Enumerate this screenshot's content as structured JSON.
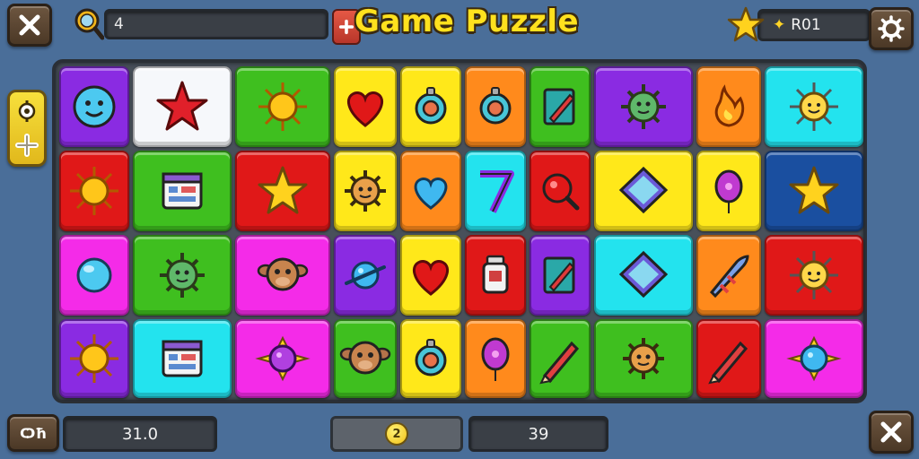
{
  "header": {
    "title": "Game Puzzle",
    "search": {
      "value": "4",
      "lens_icon": "magnifier-icon",
      "add_icon": "plus-icon"
    },
    "score": {
      "value": "R01",
      "star_icon": "star-icon"
    },
    "close_icon": "close-icon",
    "settings_icon": "gear-icon"
  },
  "side_panel": {
    "top_icon": "gear-icon",
    "bottom_icon": "plus-icon"
  },
  "footer": {
    "left_label": "Ѻħ",
    "left_value": "31.0",
    "coin_label": "2",
    "right_value": "39"
  },
  "colors": {
    "purple": "#8a2be2",
    "white": "#f6f8fb",
    "green": "#3fbf1f",
    "yellow": "#ffe81a",
    "orange": "#ff8a1c",
    "red": "#e01818",
    "blue": "#1a4fa0",
    "cyan": "#23e3ee",
    "magenta": "#f42be8",
    "title": "#ffe11e"
  },
  "board": {
    "rows": [
      [
        {
          "color": "purple",
          "icon": "blue-face-icon"
        },
        {
          "color": "white",
          "icon": "red-star-icon"
        },
        {
          "color": "green",
          "icon": "sun-icon"
        },
        {
          "color": "yellow",
          "icon": "heart-icon"
        },
        {
          "color": "yellow",
          "icon": "ring-icon"
        },
        {
          "color": "orange",
          "icon": "ring-icon"
        },
        {
          "color": "green",
          "icon": "pencil-note-icon"
        },
        {
          "color": "purple",
          "icon": "germ-face-icon"
        },
        {
          "color": "orange",
          "icon": "flame-icon"
        },
        {
          "color": "cyan",
          "icon": "sun-face-icon"
        }
      ],
      [
        {
          "color": "red",
          "icon": "sun-icon"
        },
        {
          "color": "green",
          "icon": "calendar-icon"
        },
        {
          "color": "red",
          "icon": "gold-star-icon"
        },
        {
          "color": "yellow",
          "icon": "spiky-face-icon"
        },
        {
          "color": "orange",
          "icon": "blue-heart-icon"
        },
        {
          "color": "cyan",
          "icon": "seven-icon"
        },
        {
          "color": "red",
          "icon": "search-orb-icon"
        },
        {
          "color": "yellow",
          "icon": "diamond-icon"
        },
        {
          "color": "yellow",
          "icon": "balloon-icon"
        },
        {
          "color": "blue",
          "icon": "gold-star-icon"
        }
      ],
      [
        {
          "color": "magenta",
          "icon": "blue-orb-icon"
        },
        {
          "color": "green",
          "icon": "germ-face-icon"
        },
        {
          "color": "magenta",
          "icon": "monkey-face-icon"
        },
        {
          "color": "purple",
          "icon": "planet-icon"
        },
        {
          "color": "yellow",
          "icon": "heart-icon"
        },
        {
          "color": "red",
          "icon": "jar-icon"
        },
        {
          "color": "purple",
          "icon": "pencil-note-icon"
        },
        {
          "color": "cyan",
          "icon": "diamond-icon"
        },
        {
          "color": "orange",
          "icon": "rocket-icon"
        },
        {
          "color": "red",
          "icon": "sun-face-icon"
        }
      ],
      [
        {
          "color": "purple",
          "icon": "sun-icon"
        },
        {
          "color": "cyan",
          "icon": "calendar-icon"
        },
        {
          "color": "magenta",
          "icon": "purple-planet-icon"
        },
        {
          "color": "green",
          "icon": "monkey-face-icon"
        },
        {
          "color": "yellow",
          "icon": "ring-icon"
        },
        {
          "color": "orange",
          "icon": "balloon-icon"
        },
        {
          "color": "green",
          "icon": "pencil-icon"
        },
        {
          "color": "green",
          "icon": "spiky-face-icon"
        },
        {
          "color": "red",
          "icon": "pencil-icon"
        },
        {
          "color": "magenta",
          "icon": "blue-planet-icon"
        }
      ]
    ]
  }
}
